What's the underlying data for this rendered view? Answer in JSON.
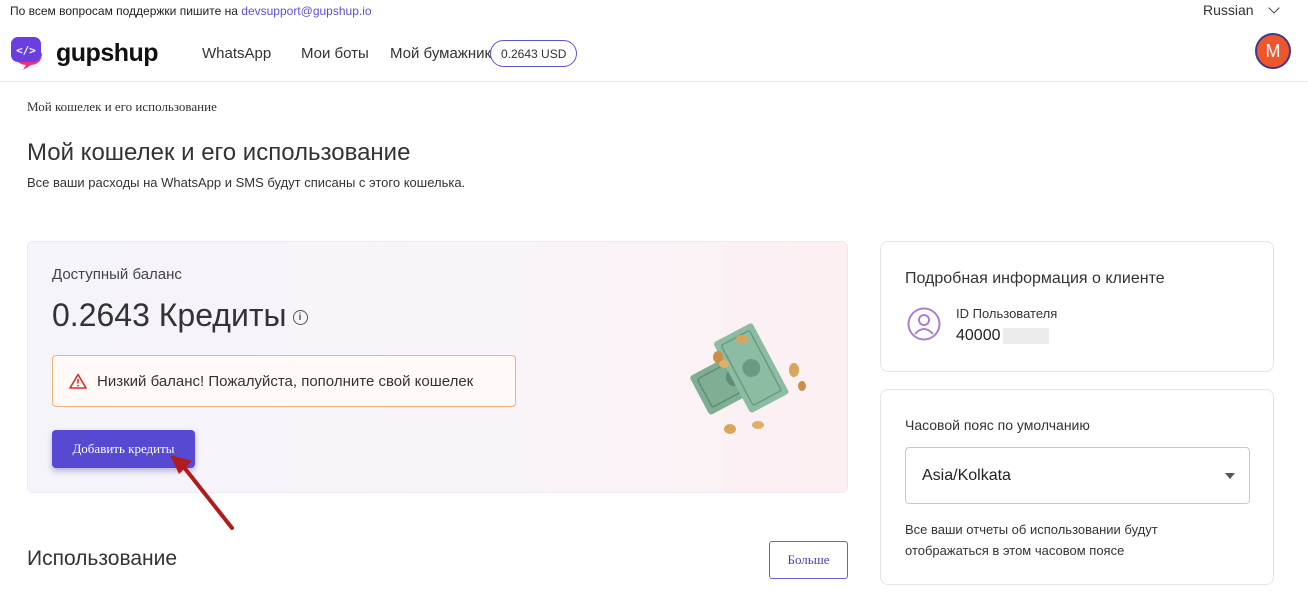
{
  "support": {
    "text": "По всем вопросам поддержки пишите на",
    "email": "devsupport@gupshup.io",
    "language": "Russian"
  },
  "nav": {
    "logo": "gupshup",
    "links": [
      "WhatsApp",
      "Мои боты",
      "Мой бумажник"
    ],
    "wallet_balance": "0.2643 USD",
    "avatar_letter": "M"
  },
  "breadcrumb": "Мой кошелек и его использование",
  "page": {
    "title": "Мой кошелек и его использование",
    "subtitle": "Все ваши расходы на WhatsApp и SMS будут списаны с этого кошелька."
  },
  "balance": {
    "label": "Доступный баланс",
    "amount": "0.2643 Кредиты",
    "warning": "Низкий баланс! Пожалуйста, пополните свой кошелек",
    "add_button": "Добавить кредиты"
  },
  "usage": {
    "title": "Использование",
    "more_button": "Больше"
  },
  "client": {
    "title": "Подробная информация о клиенте",
    "user_id_label": "ID Пользователя",
    "user_id_value": "40000"
  },
  "timezone": {
    "label": "Часовой пояс по умолчанию",
    "selected": "Asia/Kolkata",
    "note": "Все ваши отчеты об использовании будут отображаться в этом часовом поясе"
  },
  "colors": {
    "accent": "#5749d1",
    "warning_border": "#f0b37a",
    "warning_icon": "#d93025",
    "avatar_bg": "#f0562c",
    "arrow": "#b01c1c"
  }
}
